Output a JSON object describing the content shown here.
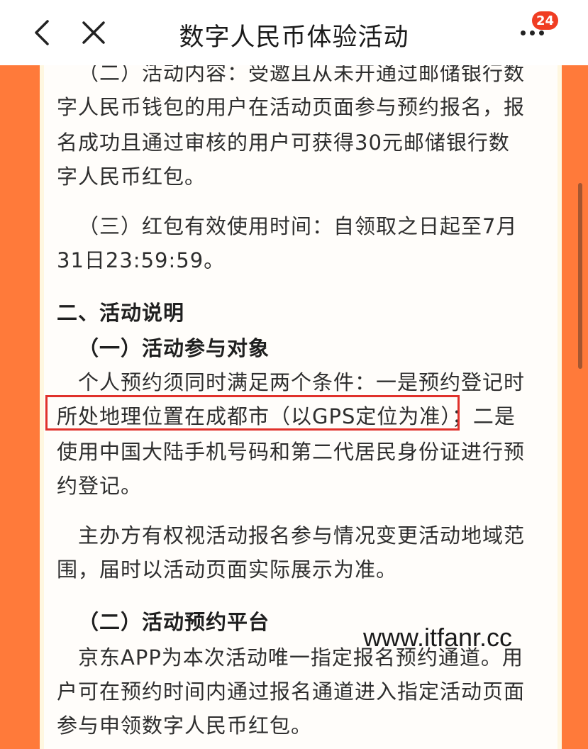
{
  "navbar": {
    "title": "数字人民币体验活动",
    "badge_count": "24",
    "back_icon": "chevron-left-icon",
    "close_icon": "close-icon",
    "more_icon": "more-dots-icon"
  },
  "content": {
    "lines": [
      "（二）活动内容：受邀且从未开通过邮储银行数",
      "字人民币钱包的用户在活动页面参与预约报名，报",
      "名成功且通过审核的用户可获得30元邮储银行数",
      "字人民币红包。",
      "（三）红包有效使用时间：自领取之日起至7月",
      "31日23:59:59。",
      "二、活动说明",
      "（一）活动参与对象",
      "个人预约须同时满足两个条件：一是预约登记时",
      "所处地理位置在成都市（以GPS定位为准）；二是",
      "使用中国大陆手机号码和第二代居民身份证进行预",
      "约登记。",
      "主办方有权视活动报名参与情况变更活动地域范",
      "围，届时以活动页面实际展示为准。",
      "（二）活动预约平台",
      "京东APP为本次活动唯一指定报名预约通道。用",
      "户可在预约时间内通过报名通道进入指定活动页面",
      "参与申领数字人民币红包。"
    ]
  },
  "watermark": "www.itfanr.cc",
  "colors": {
    "side_band": "#ff7a3a",
    "highlight_border": "#e0312b",
    "badge": "#f03d23"
  }
}
